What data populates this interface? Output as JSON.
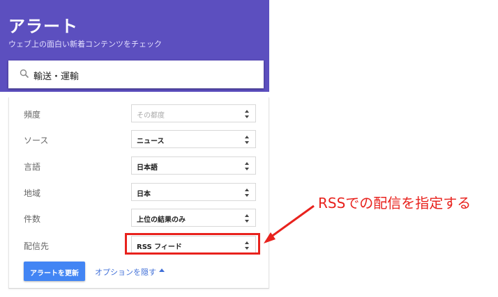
{
  "header": {
    "title": "アラート",
    "subtitle": "ウェブ上の面白い新着コンテンツをチェック"
  },
  "search": {
    "value": "輸送・運輸",
    "icon": "search-icon"
  },
  "options": [
    {
      "label": "頻度",
      "value": "その都度",
      "disabled": true
    },
    {
      "label": "ソース",
      "value": "ニュース",
      "disabled": false
    },
    {
      "label": "言語",
      "value": "日本語",
      "disabled": false
    },
    {
      "label": "地域",
      "value": "日本",
      "disabled": false
    },
    {
      "label": "件数",
      "value": "上位の結果のみ",
      "disabled": false
    },
    {
      "label": "配信先",
      "value": "RSS フィード",
      "disabled": false
    }
  ],
  "actions": {
    "update_label": "アラートを更新",
    "hide_options_label": "オプションを隠す"
  },
  "annotation": {
    "text": "RSSでの配信を指定する"
  },
  "colors": {
    "header_bg": "#5c4fbf",
    "primary_button": "#4285f4",
    "link": "#4170d8",
    "annotation": "#e8221d"
  }
}
